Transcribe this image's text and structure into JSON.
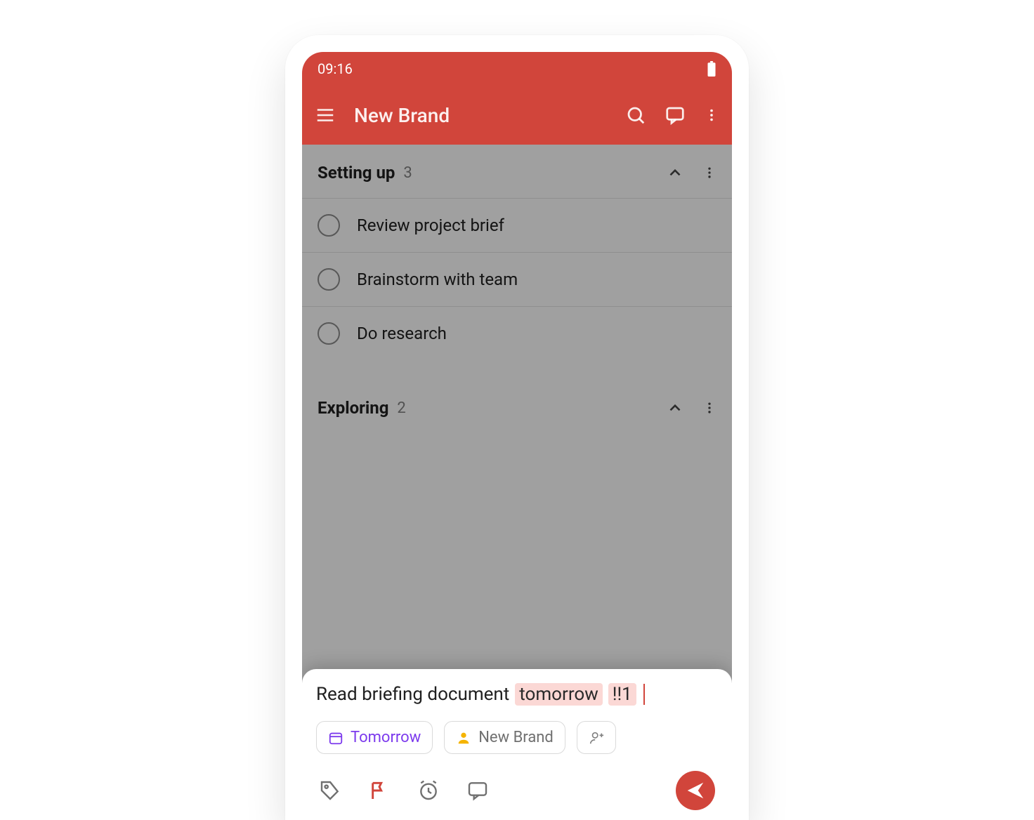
{
  "statusbar": {
    "time": "09:16"
  },
  "toolbar": {
    "title": "New Brand"
  },
  "sections": [
    {
      "title": "Setting up",
      "count": "3",
      "tasks": [
        {
          "title": "Review project brief"
        },
        {
          "title": "Brainstorm with team"
        },
        {
          "title": "Do research"
        }
      ]
    },
    {
      "title": "Exploring",
      "count": "2",
      "tasks": []
    }
  ],
  "quick_add": {
    "text_pre": "Read briefing document",
    "date_token": "tomorrow",
    "priority_token": "!!1",
    "date_chip": "Tomorrow",
    "project_chip": "New Brand"
  },
  "colors": {
    "brand": "#d1453b",
    "tomorrow": "#7c3aed",
    "project_dot": "#f5b400"
  }
}
